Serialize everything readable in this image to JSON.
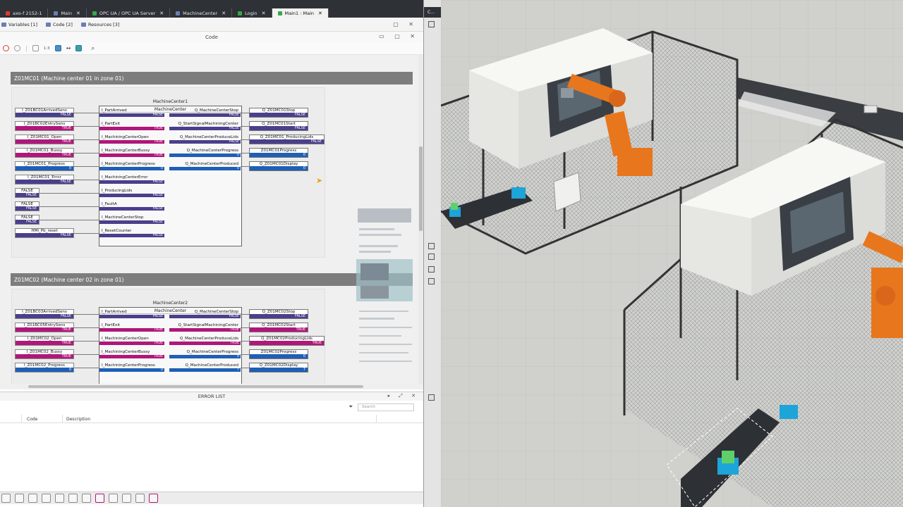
{
  "tabs": [
    {
      "label": "axo-f 2152-1",
      "color": "#e0392d"
    },
    {
      "label": "Main",
      "color": "#6b7db3"
    },
    {
      "label": "OPC UA / OPC UA Server",
      "color": "#3aa64a"
    },
    {
      "label": "MachineCenter",
      "color": "#6b7db3"
    },
    {
      "label": "Login",
      "color": "#3aa64a"
    },
    {
      "label": "Main1 : Main",
      "color": "#3aa64a"
    }
  ],
  "side_tab_label": "C...",
  "subtabs": [
    "Variables  [1]",
    "Code  [2]",
    "Resources  [3]"
  ],
  "code_panel_title": "Code",
  "zoom_label": "1:3",
  "sections": [
    {
      "title": "Z01MC01 (Machine center 01 in zone 01)",
      "instance": "MachineCenter1",
      "type": "MachineCenter",
      "inputs": [
        {
          "name": "I_Z01BC01ArrivedSens",
          "value": "FALSE",
          "kind": "p"
        },
        {
          "name": "I_Z01BC02EntrySens",
          "value": "TRUE",
          "kind": "m"
        },
        {
          "name": "I_Z01MC01_Open",
          "value": "TRUE",
          "kind": "m"
        },
        {
          "name": "I_Z01MC01_Bussy",
          "value": "TRUE",
          "kind": "m"
        },
        {
          "name": "I_Z01MC01_Progress",
          "value": "0",
          "kind": "b"
        },
        {
          "name": "I_Z01MC01_Error",
          "value": "FALSE",
          "kind": "p"
        },
        {
          "name": "FALSE",
          "value": "FALSE",
          "kind": "p"
        },
        {
          "name": "FALSE",
          "value": "FALSE",
          "kind": "p"
        },
        {
          "name": "FALSE",
          "value": "FALSE",
          "kind": "p"
        },
        {
          "name": "HMI_Pb_reset",
          "value": "FALSE",
          "kind": "p"
        }
      ],
      "fb_inputs": [
        {
          "name": "I_PartArrived",
          "value": "FALSE",
          "kind": "p"
        },
        {
          "name": "I_PartExit",
          "value": "TRUE",
          "kind": "m"
        },
        {
          "name": "I_MachiningCenterOpen",
          "value": "TRUE",
          "kind": "m"
        },
        {
          "name": "I_MachiningCenterBussy",
          "value": "TRUE",
          "kind": "m"
        },
        {
          "name": "I_MachiningCenterProgress",
          "value": "0",
          "kind": "b"
        },
        {
          "name": "I_MachiningCenterError",
          "value": "FALSE",
          "kind": "p"
        },
        {
          "name": "I_ProducingLids",
          "value": "FALSE",
          "kind": "p"
        },
        {
          "name": "I_FaultA",
          "value": "FALSE",
          "kind": "p"
        },
        {
          "name": "I_MachineCenterStop",
          "value": "FALSE",
          "kind": "p"
        },
        {
          "name": "I_ResetCounter",
          "value": "FALSE",
          "kind": "p"
        }
      ],
      "fb_outputs": [
        {
          "name": "Q_MachineCenterStop",
          "value": "FALSE",
          "kind": "p"
        },
        {
          "name": "Q_StartSignalMachiningCenter",
          "value": "FALSE",
          "kind": "p"
        },
        {
          "name": "Q_MachineCenterProduceLids",
          "value": "FALSE",
          "kind": "p"
        },
        {
          "name": "Q_MachineCenterProgress",
          "value": "0",
          "kind": "b"
        },
        {
          "name": "Q_MachineCenterProduced",
          "value": "0",
          "kind": "b"
        }
      ],
      "outputs": [
        {
          "name": "Q_Z01MC01Stop",
          "value": "FALSE",
          "kind": "p"
        },
        {
          "name": "Q_Z01MC01Start",
          "value": "FALSE",
          "kind": "p"
        },
        {
          "name": "Q_Z01MC01_ProducingLids",
          "value": "FALSE",
          "kind": "p"
        },
        {
          "name": "Z01MC01Progress",
          "value": "0",
          "kind": "b"
        },
        {
          "name": "Q_Z01MC01Display",
          "value": "0",
          "kind": "b"
        }
      ]
    },
    {
      "title": "Z01MC02 (Machine center 02 in zone 01)",
      "instance": "MachineCenter2",
      "type": "MachineCenter",
      "inputs": [
        {
          "name": "I_Z01BC03ArrivedSens",
          "value": "FALSE",
          "kind": "p"
        },
        {
          "name": "I_Z01BC05EntrySens",
          "value": "TRUE",
          "kind": "m"
        },
        {
          "name": "I_Z01MC02_Open",
          "value": "TRUE",
          "kind": "m"
        },
        {
          "name": "I_Z01MC02_Bussy",
          "value": "TRUE",
          "kind": "m"
        },
        {
          "name": "I_Z01MC02_Progress",
          "value": "0",
          "kind": "b"
        }
      ],
      "fb_inputs": [
        {
          "name": "I_PartArrived",
          "value": "FALSE",
          "kind": "p"
        },
        {
          "name": "I_PartExit",
          "value": "TRUE",
          "kind": "m"
        },
        {
          "name": "I_MachiningCenterOpen",
          "value": "TRUE",
          "kind": "m"
        },
        {
          "name": "I_MachiningCenterBussy",
          "value": "TRUE",
          "kind": "m"
        },
        {
          "name": "I_MachiningCenterProgress",
          "value": "0",
          "kind": "b"
        }
      ],
      "fb_outputs": [
        {
          "name": "Q_MachineCenterStop",
          "value": "FALSE",
          "kind": "p"
        },
        {
          "name": "Q_StartSignalMachiningCenter",
          "value": "TRUE",
          "kind": "m"
        },
        {
          "name": "Q_MachineCenterProduceLids",
          "value": "TRUE",
          "kind": "m"
        },
        {
          "name": "Q_MachineCenterProgress",
          "value": "0",
          "kind": "b"
        },
        {
          "name": "Q_MachineCenterProduced",
          "value": "7",
          "kind": "b"
        }
      ],
      "outputs": [
        {
          "name": "Q_Z01MC02Stop",
          "value": "FALSE",
          "kind": "p"
        },
        {
          "name": "Q_Z01MC02Start",
          "value": "TRUE",
          "kind": "m"
        },
        {
          "name": "Q_Z01MC02ProducingLids",
          "value": "TRUE",
          "kind": "m"
        },
        {
          "name": "Z01MC02Progress",
          "value": "0",
          "kind": "b"
        },
        {
          "name": "Q_Z01MC02Display",
          "value": "7",
          "kind": "b"
        }
      ]
    }
  ],
  "error_list": {
    "title": "ERROR LIST",
    "search_placeholder": "Search",
    "columns": [
      "Code",
      "Description"
    ]
  },
  "colors": {
    "false_value": "#4a3f8c",
    "true_value": "#b0177a",
    "numeric_value": "#1f5fb5",
    "robot": "#e8761c",
    "machine_body": "#f2f2ef",
    "fence": "#3a4048",
    "floor": "#cfd0cc"
  }
}
